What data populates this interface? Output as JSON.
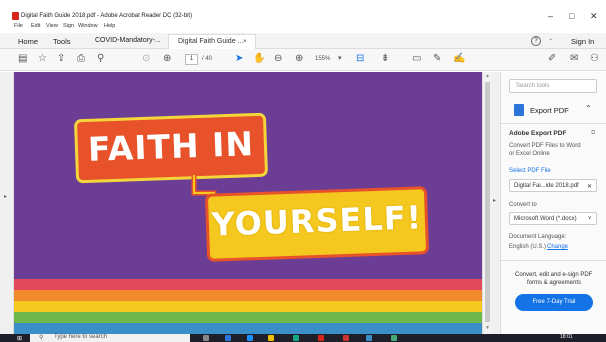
{
  "titlebar": {
    "title": "Digital Faith Guide 2018.pdf - Adobe Acrobat Reader DC (32-bit)",
    "minimize": "–",
    "maximize": "□",
    "close": "✕"
  },
  "menu": [
    "File",
    "Edit",
    "View",
    "Sign",
    "Window",
    "Help"
  ],
  "tabs": {
    "home": "Home",
    "tools": "Tools",
    "covid": "COVID-Mandatory-...",
    "doc": "Digital Faith Guide ...",
    "doc_close": "×",
    "help_icon": "?",
    "bell_icon": "🔔",
    "signin": "Sign In"
  },
  "toolbar": {
    "page_current": "1",
    "page_total": "/ 40",
    "zoom": "155%"
  },
  "document": {
    "line1": "FAITH IN",
    "line2": "YOURSELF!",
    "stripe_colors": [
      "#e24a5b",
      "#f08a2b",
      "#f4c81e",
      "#6cb84a",
      "#3a8fc9"
    ]
  },
  "panel": {
    "search_placeholder": "Search tools",
    "export_title": "Export PDF",
    "adobe_export": "Adobe Export PDF",
    "desc1": "Convert PDF Files to Word",
    "desc2": "or Excel Online",
    "select_file": "Select PDF File",
    "file_name": "Digital Fai...ide 2018.pdf",
    "file_clear": "✕",
    "convert_to": "Convert to",
    "format": "Microsoft Word (*.docx)",
    "doc_lang": "Document Language:",
    "lang_value": "English (U.S.)",
    "change": "Change",
    "promo1": "Convert, edit and e-sign PDF",
    "promo2": "forms & agreements",
    "cta": "Free 7-Day Trial"
  },
  "taskbar": {
    "search": "Type here to search",
    "time": "18:01"
  },
  "colors": {
    "doc_bg": "#6b3d94",
    "accent_blue": "#1473e6",
    "banner_orange": "#e8522b",
    "banner_yellow": "#f4c81e"
  }
}
